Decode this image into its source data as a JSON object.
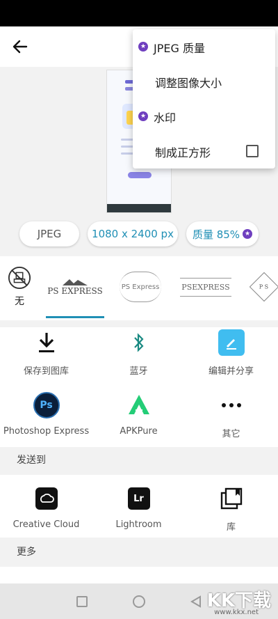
{
  "menu": {
    "items": [
      {
        "label": "JPEG 质量",
        "premium": true
      },
      {
        "label": "调整图像大小",
        "premium": false
      },
      {
        "label": "水印",
        "premium": true
      },
      {
        "label": "制成正方形",
        "premium": false,
        "checked": false
      }
    ]
  },
  "chips": {
    "format": "JPEG",
    "size": "1080 x 2400 px",
    "quality": "质量 85%"
  },
  "watermarks": {
    "none_label": "无",
    "items": [
      "PS EXPRESS",
      "PS Express",
      "PSEXPRESS"
    ],
    "extra_letters": "P S"
  },
  "share": {
    "row1": [
      {
        "label": "保存到图库",
        "icon": "download-icon"
      },
      {
        "label": "蓝牙",
        "icon": "bluetooth-icon"
      },
      {
        "label": "编辑并分享",
        "icon": "edit-share-icon"
      }
    ],
    "row2": [
      {
        "label": "Photoshop Express",
        "icon": "photoshop-express-icon"
      },
      {
        "label": "APKPure",
        "icon": "apkpure-icon"
      },
      {
        "label": "其它",
        "icon": "more-icon"
      }
    ]
  },
  "sendto": {
    "title": "发送到",
    "items": [
      {
        "label": "Creative Cloud",
        "icon": "creative-cloud-icon"
      },
      {
        "label": "Lightroom",
        "icon": "lightroom-icon"
      },
      {
        "label": "库",
        "icon": "library-icon"
      }
    ]
  },
  "more": {
    "title": "更多"
  },
  "watermark_site": {
    "logo": "KK下载",
    "url": "www.kkx.net"
  },
  "colors": {
    "accent": "#1f8fb5",
    "premium": "#6f3fbf"
  }
}
